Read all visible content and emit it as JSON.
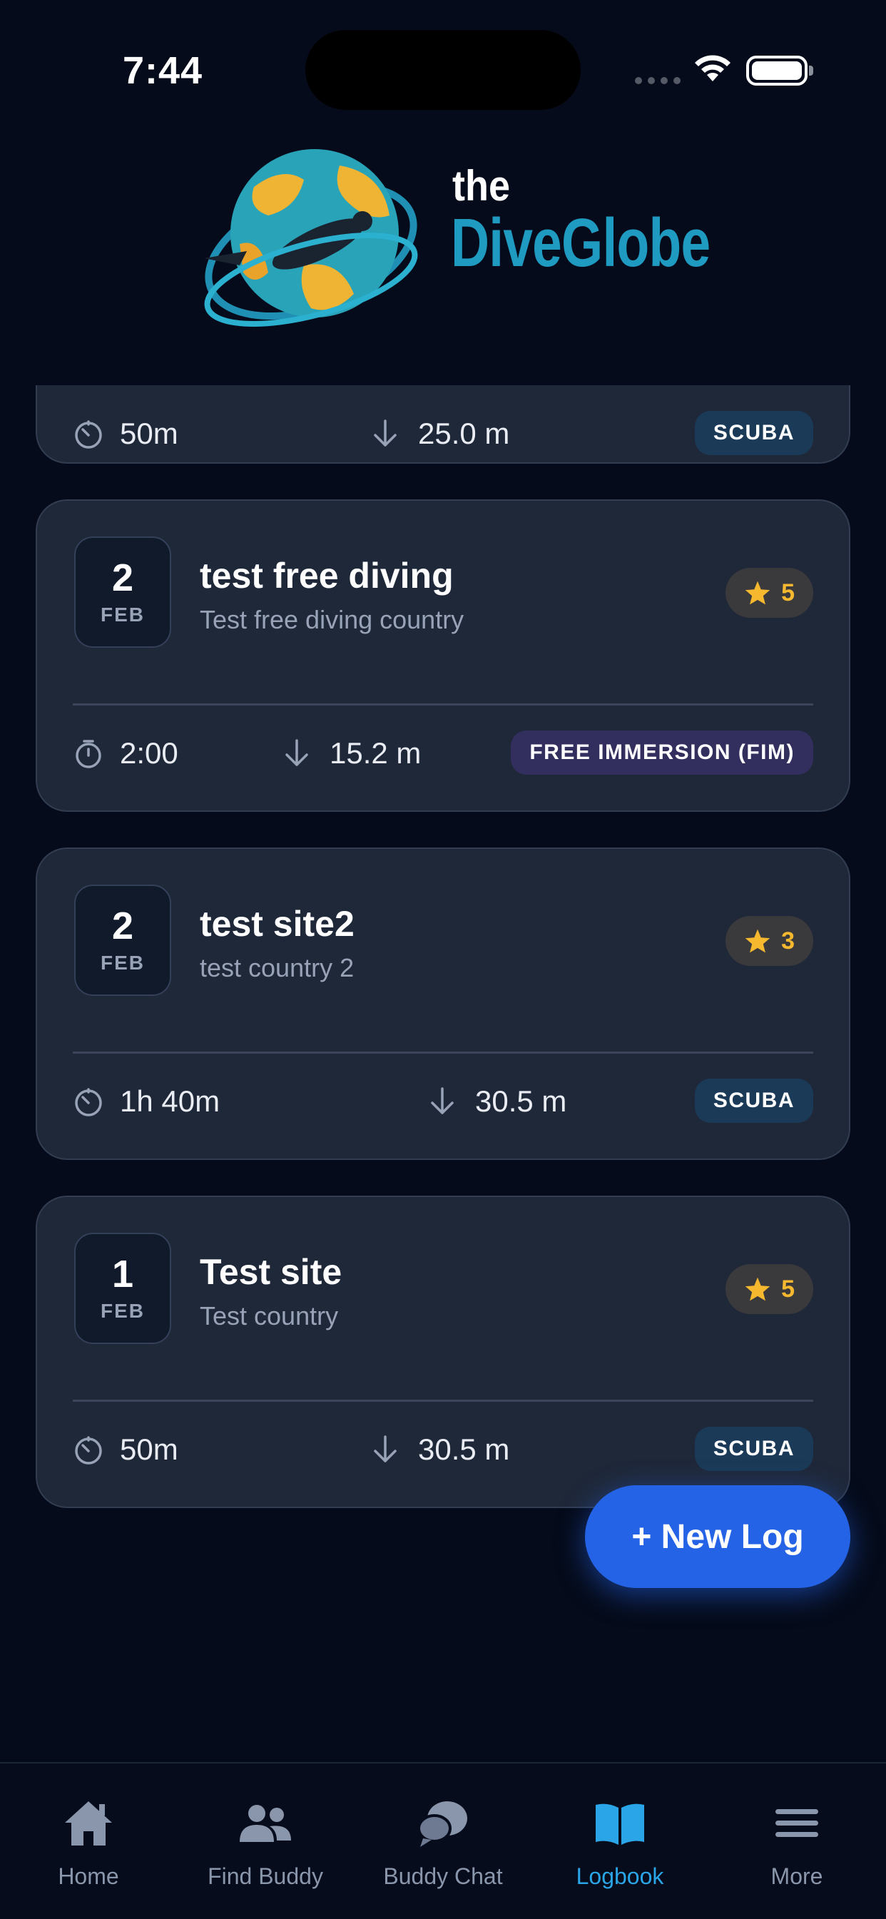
{
  "status_bar": {
    "time": "7:44"
  },
  "logo": {
    "the": "the",
    "name": "DiveGlobe"
  },
  "logs": [
    {
      "day": "",
      "month": "",
      "title": "",
      "country": "",
      "rating": "",
      "duration": "50m",
      "depth": "25.0 m",
      "type": "SCUBA",
      "partial": true
    },
    {
      "day": "2",
      "month": "FEB",
      "title": "test free diving",
      "country": "Test free diving country",
      "rating": "5",
      "duration": "2:00",
      "depth": "15.2 m",
      "type": "FREE IMMERSION (FIM)"
    },
    {
      "day": "2",
      "month": "FEB",
      "title": "test site2",
      "country": "test country 2",
      "rating": "3",
      "duration": "1h 40m",
      "depth": "30.5 m",
      "type": "SCUBA"
    },
    {
      "day": "1",
      "month": "FEB",
      "title": "Test site",
      "country": "Test country",
      "rating": "5",
      "duration": "50m",
      "depth": "30.5 m",
      "type": "SCUBA"
    }
  ],
  "fab": {
    "label": "+ New Log"
  },
  "tabs": [
    {
      "label": "Home",
      "icon": "home-icon"
    },
    {
      "label": "Find Buddy",
      "icon": "people-icon"
    },
    {
      "label": "Buddy Chat",
      "icon": "chat-icon"
    },
    {
      "label": "Logbook",
      "icon": "book-icon",
      "active": true
    },
    {
      "label": "More",
      "icon": "menu-icon"
    }
  ],
  "colors": {
    "background": "#050b1a",
    "card": "#1f2839",
    "accent": "#2563e6",
    "active_tab": "#2aa6e8",
    "star": "#f5b82e"
  }
}
